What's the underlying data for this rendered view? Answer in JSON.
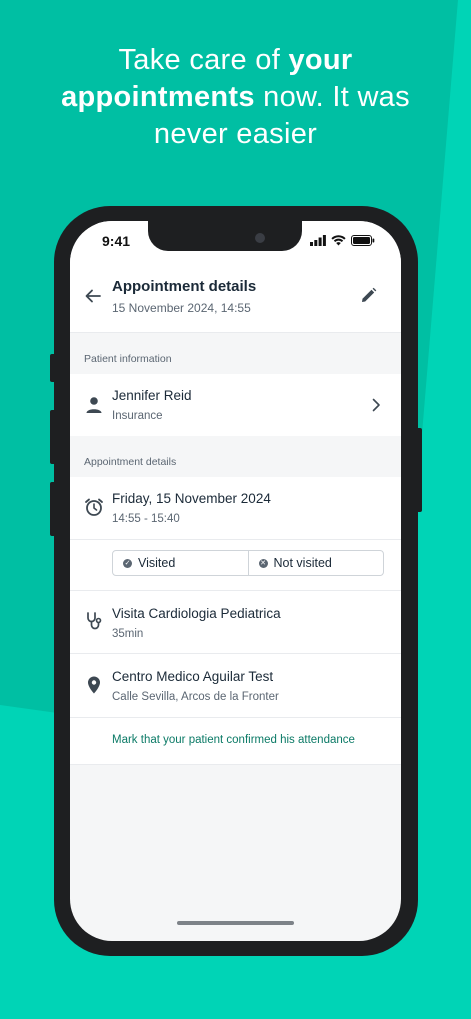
{
  "headline": {
    "part1": "Take care of ",
    "bold1": "your",
    "bold2": "appointments",
    "part2": " now. It was",
    "part3": "never easier"
  },
  "status_bar": {
    "time": "9:41"
  },
  "header": {
    "title": "Appointment details",
    "subtitle": "15 November 2024, 14:55"
  },
  "patient_section": {
    "label": "Patient information",
    "name": "Jennifer Reid",
    "detail": "Insurance"
  },
  "appointment_section": {
    "label": "Appointment details",
    "date": "Friday, 15 November 2024",
    "time_range": "14:55 - 15:40",
    "visited_label": "Visited",
    "not_visited_label": "Not visited",
    "service": "Visita Cardiologia Pediatrica",
    "duration": "35min",
    "location_name": "Centro Medico Aguilar Test",
    "location_address": "Calle Sevilla, Arcos de la Fronter",
    "confirm_link": "Mark that your patient confirmed his attendance"
  },
  "colors": {
    "background": "#00c4a7",
    "accent_link": "#0b7a66",
    "phone_body": "#1e1f21"
  },
  "icons": [
    "back-arrow-icon",
    "edit-pencil-icon",
    "person-icon",
    "chevron-right-icon",
    "alarm-clock-icon",
    "check-circle-icon",
    "x-circle-icon",
    "stethoscope-icon",
    "location-pin-icon",
    "signal-icon",
    "wifi-icon",
    "battery-icon"
  ]
}
